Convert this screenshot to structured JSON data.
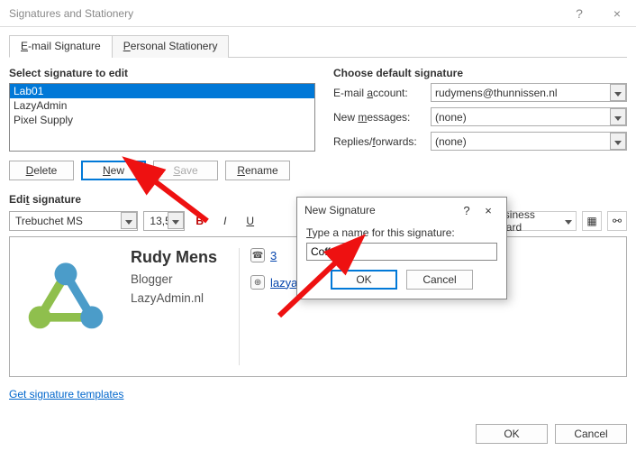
{
  "window": {
    "title": "Signatures and Stationery"
  },
  "tabs": {
    "email": "E-mail Signature",
    "stationery": "Personal Stationery"
  },
  "select_label": "Select signature to edit",
  "signatures": [
    "Lab01",
    "LazyAdmin",
    "Pixel Supply"
  ],
  "buttons": {
    "delete": "Delete",
    "new": "New",
    "save": "Save",
    "rename": "Rename",
    "ok": "OK",
    "cancel": "Cancel"
  },
  "default_label": "Choose default signature",
  "fields": {
    "account_label": "E-mail account:",
    "account_value": "rudymens@thunnissen.nl",
    "newmsg_label": "New messages:",
    "newmsg_value": "(none)",
    "replies_label": "Replies/forwards:",
    "replies_value": "(none)"
  },
  "edit_label": "Edit signature",
  "toolbar": {
    "font": "Trebuchet MS",
    "size": "13,5",
    "bold": "B",
    "italic": "I",
    "underline": "U",
    "business_card": "Business Card"
  },
  "signature_preview": {
    "name": "Rudy Mens",
    "role": "Blogger",
    "site": "LazyAdmin.nl",
    "phone_last": "3",
    "link": "lazyadmin.nl"
  },
  "templates_link": "Get signature templates",
  "modal": {
    "title": "New Signature",
    "label": "Type a name for this signature:",
    "value": "Coffee",
    "ok": "OK",
    "cancel": "Cancel"
  }
}
